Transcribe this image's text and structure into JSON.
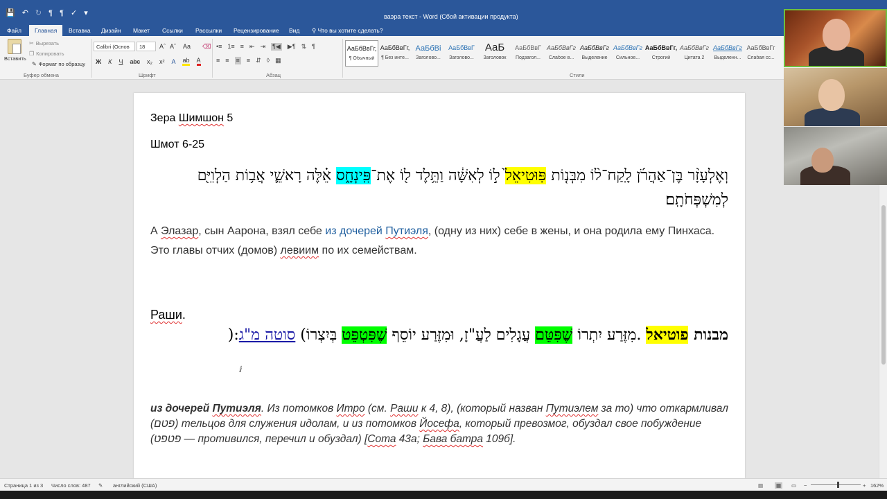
{
  "window": {
    "title": "ваэра текст - Word (Сбой активации продукта)"
  },
  "tabs": [
    {
      "label": "Файл"
    },
    {
      "label": "Главная"
    },
    {
      "label": "Вставка"
    },
    {
      "label": "Дизайн"
    },
    {
      "label": "Макет"
    },
    {
      "label": "Ссылки"
    },
    {
      "label": "Рассылки"
    },
    {
      "label": "Рецензирование"
    },
    {
      "label": "Вид"
    }
  ],
  "tell_me": "Что вы хотите сделать?",
  "clipboard": {
    "paste": "Вставить",
    "cut": "Вырезать",
    "copy": "Копировать",
    "format_painter": "Формат по образцу",
    "group": "Буфер обмена"
  },
  "font": {
    "name": "Calibri (Основ",
    "size": "18",
    "group": "Шрифт"
  },
  "paragraph_group": "Абзац",
  "styles_group": "Стили",
  "styles": [
    {
      "sample": "АаБбВвГг,",
      "name": "¶ Обычный"
    },
    {
      "sample": "АаБбВвГг,",
      "name": "¶ Без инте..."
    },
    {
      "sample": "АаБбВі",
      "name": "Заголово..."
    },
    {
      "sample": "АаБбВвГ",
      "name": "Заголово..."
    },
    {
      "sample": "АаБ",
      "name": "Заголовок"
    },
    {
      "sample": "АаБбВвГ",
      "name": "Подзагол..."
    },
    {
      "sample": "АаБбВвГг",
      "name": "Слабое в..."
    },
    {
      "sample": "АаБбВвГг",
      "name": "Выделение"
    },
    {
      "sample": "АаБбВвГг",
      "name": "Сильное..."
    },
    {
      "sample": "АаБбВвГг,",
      "name": "Строгий"
    },
    {
      "sample": "АаБбВвГг",
      "name": "Цитата 2"
    },
    {
      "sample": "АаБбВвГг",
      "name": "Выделенн..."
    },
    {
      "sample": "АаБбВвГг",
      "name": "Слабая сс..."
    }
  ],
  "colors": {
    "titlebar": "#2b579a",
    "highlight_cyan": "#00ffff",
    "highlight_yellow": "#ffff00",
    "highlight_green": "#00ff00"
  },
  "doc": {
    "line1_a": "Зера ",
    "line1_b": "Шимшон",
    "line1_c": " 5",
    "line2": "Шмот 6-25",
    "heb1_a": "וְאֶלְעָזָ֨ר בֶּן־אַהֲרֹ֜ן לָֽקַח־ל֨וֹ מִבְּנ֤וֹת ",
    "heb1_b": "פּֽוּטִיאֵל֙",
    "heb1_c": " ל֣וֹ לְאִשָּׁ֔ה וַתֵּ֥לֶד ל֖וֹ אֶת־",
    "heb1_d": "פִּֽינְחָ֑ס",
    "heb1_e": " אֵ֗לֶּה רָאשֵׁ֛י אֲב֥וֹת הַלְוִיִּ֖ם לְמִשְׁפְּחֹתָֽם׃",
    "ru1_a": "А ",
    "ru1_b": "Элазар",
    "ru1_c": ", сын Аарона, взял себе ",
    "ru1_d": "из дочерей ",
    "ru1_e": "Путиэля",
    "ru1_f": ", (одну из них) себе в жены, и она родила ему Пинхаса. Это главы отчих (домов) ",
    "ru1_g": "левиим",
    "ru1_h": " по их семействам.",
    "rashi": "Раши",
    "rashi_dot": ".",
    "heb2_a": "מבנות ",
    "heb2_b": "פוטיאל",
    "heb2_c": " .מִזֶּרַע יִתְרוֹ ",
    "heb2_d": "שֶׁפִּטֵּם",
    "heb2_e": " עֲגָלִים לַעֲ\"זָ, וּמִזֶּרַע יוֹסֵף ",
    "heb2_f": "שֶׁפִּטְפֵּט",
    "heb2_g": " בְּיִצְרוֹ) ",
    "heb2_h": "סוטה מ\"ג",
    "heb2_i": ":(",
    "ru2_a": "из дочерей ",
    "ru2_b": "Путиэля",
    "ru2_c": ". Из потомков ",
    "ru2_d": "Итро",
    "ru2_e": " (см. ",
    "ru2_f": "Раши",
    "ru2_g": " к 4, 8), (который назван ",
    "ru2_h": "Путиэлем",
    "ru2_i": " за то) что откармливал (פטם) тельцов для служения идолам, и из потомков ",
    "ru2_j": "Йосефа",
    "ru2_k": ", который превозмог, обуздал свое побуждение (פטפט — противился, перечил и обуздал) [",
    "ru2_l": "Сота",
    "ru2_m": " 43а; ",
    "ru2_n": "Бава батра",
    "ru2_o": " 109б]."
  },
  "status": {
    "page": "Страница 1 из 3",
    "words": "Число слов: 487",
    "lang": "английский (США)",
    "zoom": "162%"
  }
}
